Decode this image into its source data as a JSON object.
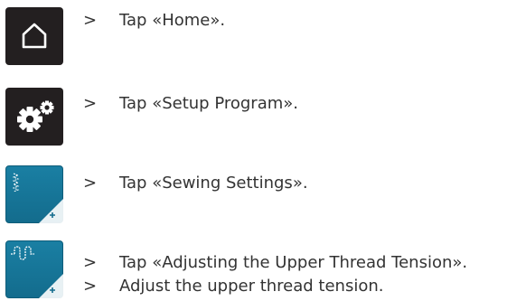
{
  "colors": {
    "dark_button": "#231f20",
    "teal_button": "#1a7fa3",
    "text": "#333333"
  },
  "steps": [
    {
      "icon": "home-icon",
      "lines": [
        {
          "marker": ">",
          "text": "Tap «Home»."
        }
      ]
    },
    {
      "icon": "setup-gears-icon",
      "lines": [
        {
          "marker": ">",
          "text": "Tap «Setup Program»."
        }
      ]
    },
    {
      "icon": "sewing-settings-icon",
      "lines": [
        {
          "marker": ">",
          "text": "Tap «Sewing Settings»."
        }
      ]
    },
    {
      "icon": "thread-tension-icon",
      "lines": [
        {
          "marker": ">",
          "text": "Tap «Adjusting the Upper Thread Tension»."
        },
        {
          "marker": ">",
          "text": "Adjust the upper thread tension."
        }
      ]
    }
  ]
}
